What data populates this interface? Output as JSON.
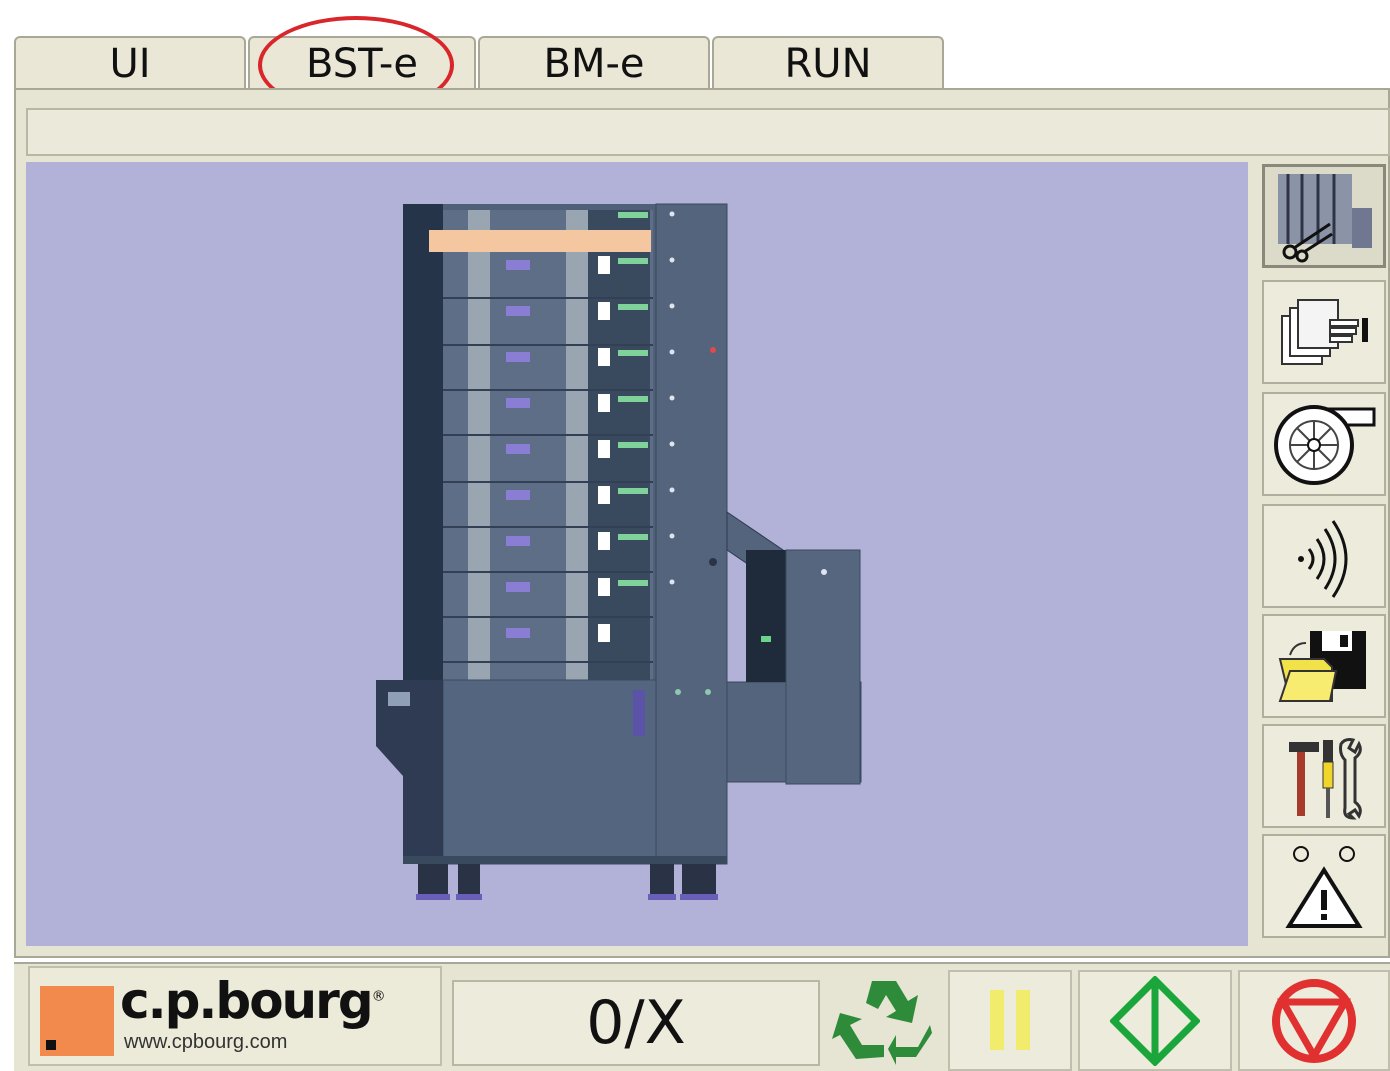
{
  "tabs": [
    {
      "label": "UI"
    },
    {
      "label": "BST-e",
      "highlighted": true
    },
    {
      "label": "BM-e"
    },
    {
      "label": "RUN"
    }
  ],
  "message_bar": {
    "text": ""
  },
  "side_buttons": [
    {
      "icon": "machine-cut-icon",
      "active": true
    },
    {
      "icon": "paper-stack-hand-icon"
    },
    {
      "icon": "blower-fan-icon"
    },
    {
      "icon": "sensor-wave-icon"
    },
    {
      "icon": "save-folder-icon"
    },
    {
      "icon": "tools-icon"
    },
    {
      "icon": "warning-icon"
    }
  ],
  "brand": {
    "name": "c.p.bourg",
    "registered_mark": "®",
    "url": "www.cpbourg.com",
    "accent_color": "#f28a4e"
  },
  "counter": {
    "value": "0/X"
  },
  "controls": [
    {
      "icon": "recycle-icon",
      "color": "#2e8b3a"
    },
    {
      "icon": "pause-icon",
      "color": "#f1ec6b"
    },
    {
      "icon": "start-icon",
      "color": "#1aa63a"
    },
    {
      "icon": "stop-icon",
      "color": "#e03030"
    }
  ]
}
